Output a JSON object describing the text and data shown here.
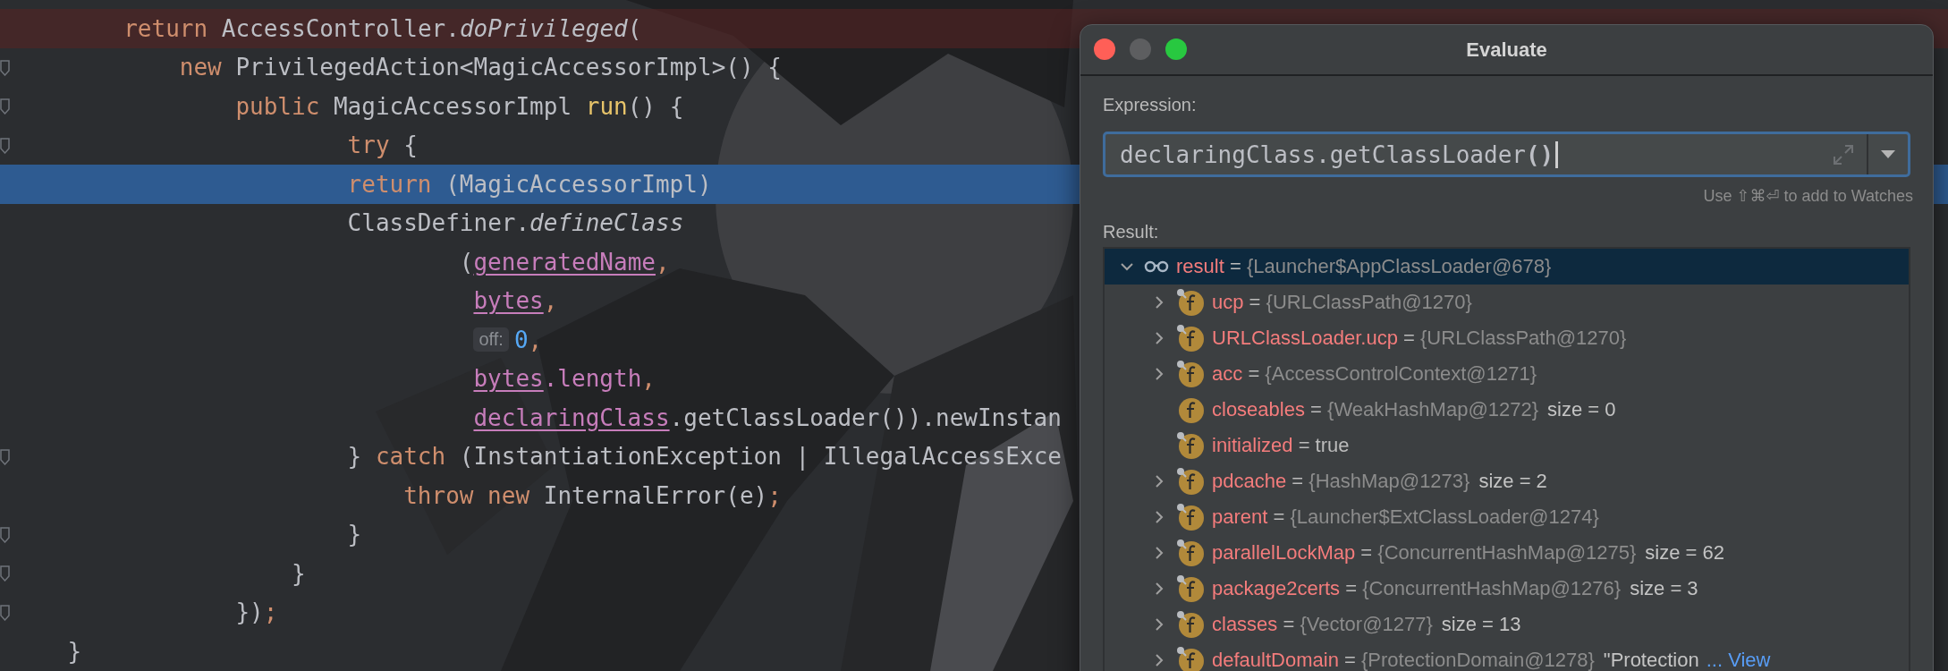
{
  "editor": {
    "lines": [
      {
        "kind": "breakpoint",
        "fold": false,
        "tokens": [
          {
            "kind": "kw",
            "s": "        return"
          },
          {
            "kind": "plain",
            "s": " AccessController."
          },
          {
            "kind": "italic",
            "s": "doPrivileged"
          },
          {
            "kind": "plain",
            "s": "("
          }
        ]
      },
      {
        "kind": "plain",
        "fold": true,
        "tokens": [
          {
            "kind": "kw",
            "s": "            new"
          },
          {
            "kind": "plain",
            "s": " PrivilegedAction<MagicAccessorImpl>() {"
          }
        ]
      },
      {
        "kind": "plain",
        "fold": true,
        "tokens": [
          {
            "kind": "kw",
            "s": "                public"
          },
          {
            "kind": "plain",
            "s": " MagicAccessorImpl "
          },
          {
            "kind": "call",
            "s": "run"
          },
          {
            "kind": "plain",
            "s": "() {"
          }
        ]
      },
      {
        "kind": "plain",
        "fold": true,
        "tokens": [
          {
            "kind": "kw",
            "s": "                        try"
          },
          {
            "kind": "plain",
            "s": " {"
          }
        ]
      },
      {
        "kind": "execution",
        "fold": false,
        "tokens": [
          {
            "kind": "kw",
            "s": "                        return"
          },
          {
            "kind": "plain",
            "s": " (MagicAccessorImpl)"
          }
        ]
      },
      {
        "kind": "plain",
        "fold": false,
        "tokens": [
          {
            "kind": "plain",
            "s": "                        ClassDefiner."
          },
          {
            "kind": "italic",
            "s": "defineClass"
          }
        ]
      },
      {
        "kind": "plain",
        "fold": false,
        "tokens": [
          {
            "kind": "plain",
            "s": "                                ("
          },
          {
            "kind": "field",
            "s": "generatedName"
          },
          {
            "kind": "kw",
            "s": ","
          }
        ]
      },
      {
        "kind": "plain",
        "fold": false,
        "tokens": [
          {
            "kind": "field",
            "s": "                                 bytes"
          },
          {
            "kind": "kw",
            "s": ","
          }
        ]
      },
      {
        "kind": "plain",
        "fold": false,
        "tokens": [
          {
            "kind": "hint",
            "s": "                                 off:"
          },
          {
            "kind": "num",
            "s": "0"
          },
          {
            "kind": "kw",
            "s": ","
          }
        ]
      },
      {
        "kind": "plain",
        "fold": false,
        "tokens": [
          {
            "kind": "field",
            "s": "                                 bytes"
          },
          {
            "kind": "member",
            "s": ".length"
          },
          {
            "kind": "kw",
            "s": ","
          }
        ]
      },
      {
        "kind": "plain",
        "fold": false,
        "tokens": [
          {
            "kind": "field",
            "s": "                                 declaringClass"
          },
          {
            "kind": "plain",
            "s": ".getClassLoader()).newInstan"
          }
        ]
      },
      {
        "kind": "plain",
        "fold": true,
        "tokens": [
          {
            "kind": "plain",
            "s": "                        } "
          },
          {
            "kind": "kw",
            "s": "catch"
          },
          {
            "kind": "plain",
            "s": " (InstantiationException | IllegalAccessExce"
          }
        ]
      },
      {
        "kind": "plain",
        "fold": false,
        "tokens": [
          {
            "kind": "kw",
            "s": "                            throw new"
          },
          {
            "kind": "plain",
            "s": " InternalError(e)"
          },
          {
            "kind": "kw",
            "s": ";"
          }
        ]
      },
      {
        "kind": "plain",
        "fold": true,
        "tokens": [
          {
            "kind": "plain",
            "s": "                        }"
          }
        ]
      },
      {
        "kind": "plain",
        "fold": true,
        "tokens": [
          {
            "kind": "plain",
            "s": "                    }"
          }
        ]
      },
      {
        "kind": "plain",
        "fold": true,
        "tokens": [
          {
            "kind": "plain",
            "s": "                })"
          },
          {
            "kind": "kw",
            "s": ";"
          }
        ]
      },
      {
        "kind": "plain",
        "fold": false,
        "tokens": [
          {
            "kind": "plain",
            "s": "    }"
          }
        ]
      }
    ]
  },
  "dialog": {
    "title": "Evaluate",
    "expression_label": "Expression:",
    "expression": "declaringClass.getClassLoader**()**",
    "watch_hint": "Use ⇧⌘⏎ to add to Watches",
    "result_label": "Result:",
    "result": {
      "name": "result",
      "operator": "=",
      "value": "{Launcher$AppClassLoader@678}",
      "expanded": true,
      "selected": true,
      "children": [
        {
          "name": "ucp",
          "operator": "=",
          "value": "{URLClassPath@1270}",
          "kind": "object",
          "expandable": true,
          "final": true
        },
        {
          "name": "URLClassLoader.ucp",
          "operator": "=",
          "value": "{URLClassPath@1270}",
          "kind": "object",
          "expandable": true,
          "final": true
        },
        {
          "name": "acc",
          "operator": "=",
          "value": "{AccessControlContext@1271}",
          "kind": "object",
          "expandable": true,
          "final": true
        },
        {
          "name": "closeables",
          "operator": "=",
          "value": "{WeakHashMap@1272}",
          "extra": "size = 0",
          "kind": "object",
          "expandable": false,
          "final": false
        },
        {
          "name": "initialized",
          "operator": "=",
          "value": "true",
          "kind": "primitive",
          "expandable": false,
          "final": true
        },
        {
          "name": "pdcache",
          "operator": "=",
          "value": "{HashMap@1273}",
          "extra": "size = 2",
          "kind": "object",
          "expandable": true,
          "final": true
        },
        {
          "name": "parent",
          "operator": "=",
          "value": "{Launcher$ExtClassLoader@1274}",
          "kind": "object",
          "expandable": true,
          "final": true
        },
        {
          "name": "parallelLockMap",
          "operator": "=",
          "value": "{ConcurrentHashMap@1275}",
          "extra": "size = 62",
          "kind": "object",
          "expandable": true,
          "final": true
        },
        {
          "name": "package2certs",
          "operator": "=",
          "value": "{ConcurrentHashMap@1276}",
          "extra": "size = 3",
          "kind": "object",
          "expandable": true,
          "final": true
        },
        {
          "name": "classes",
          "operator": "=",
          "value": "{Vector@1277}",
          "extra": "size = 13",
          "kind": "object",
          "expandable": true,
          "final": true
        },
        {
          "name": "defaultDomain",
          "operator": "=",
          "value": "{ProtectionDomain@1278}",
          "extra": "\"Protection",
          "link": "... View",
          "kind": "object",
          "expandable": true,
          "final": true
        }
      ]
    }
  }
}
